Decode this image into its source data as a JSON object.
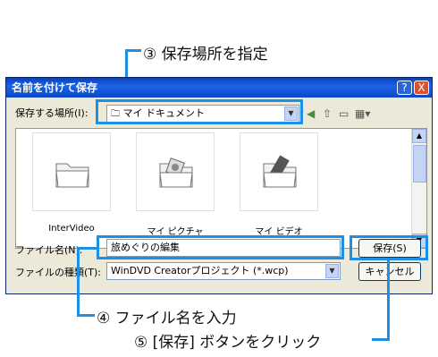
{
  "annotations": {
    "step3": "③ 保存場所を指定",
    "step4": "④ ファイル名を入力",
    "step5": "⑤ [保存] ボタンをクリック"
  },
  "dialog": {
    "title": "名前を付けて保存",
    "help_label": "?",
    "close_label": "X",
    "save_in_label": "保存する場所(I):",
    "save_in_value": "マイ ドキュメント",
    "files": [
      {
        "label": "InterVideo",
        "icon": "folder-icon"
      },
      {
        "label": "マイ ピクチャ",
        "icon": "pictures-folder-icon"
      },
      {
        "label": "マイ ビデオ",
        "icon": "videos-folder-icon"
      }
    ],
    "filename_label": "ファイル名(N):",
    "filename_value": "旅めぐりの編集",
    "filetype_label": "ファイルの種類(T):",
    "filetype_value": "WinDVD Creatorプロジェクト (*.wcp)",
    "save_button": "保存(S)",
    "cancel_button": "キャンセル"
  },
  "colors": {
    "accent": "#1e8fe6",
    "titlebar": "#0a3fb8",
    "dialog_bg": "#ece9d8"
  }
}
